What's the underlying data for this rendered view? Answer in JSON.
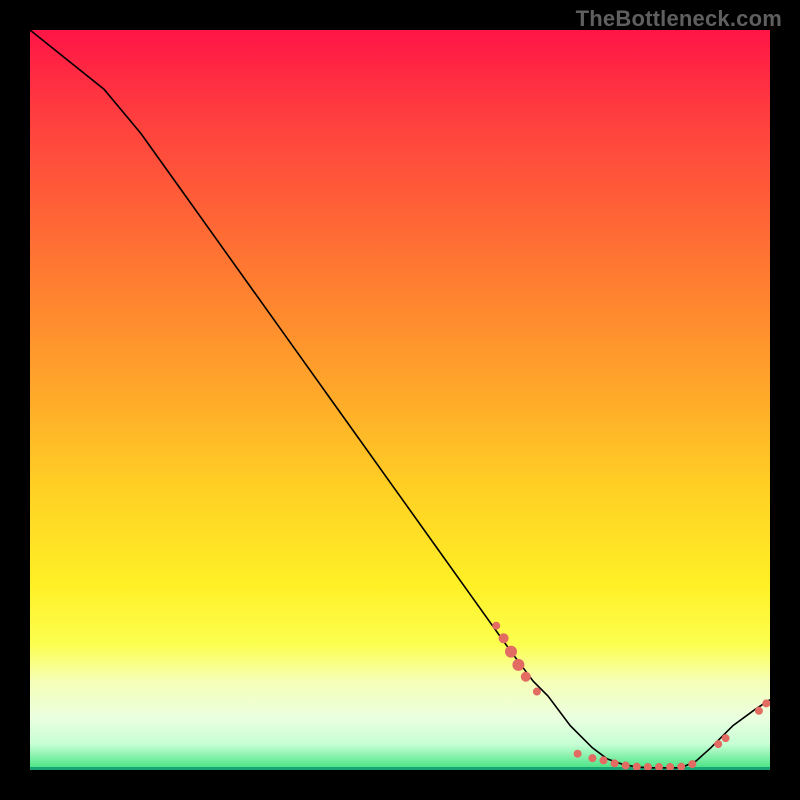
{
  "watermark": "TheBottleneck.com",
  "chart_data": {
    "type": "line",
    "title": "",
    "xlabel": "",
    "ylabel": "",
    "xlim": [
      0,
      100
    ],
    "ylim": [
      0,
      100
    ],
    "grid": false,
    "legend": false,
    "annotations": [],
    "curve": {
      "x": [
        0,
        5,
        10,
        15,
        20,
        25,
        30,
        35,
        40,
        45,
        50,
        55,
        60,
        65,
        68,
        70,
        73,
        76,
        78,
        80,
        82,
        84,
        86,
        88,
        90,
        92,
        95,
        98,
        100
      ],
      "y": [
        100,
        96,
        92,
        86,
        79,
        72,
        65,
        58,
        51,
        44,
        37,
        30,
        23,
        16,
        12,
        10,
        6,
        3,
        1.5,
        0.8,
        0.4,
        0.3,
        0.3,
        0.3,
        1.2,
        3.0,
        6.0,
        8.2,
        9.5
      ]
    },
    "scatter_clusters": [
      {
        "name": "left-slope-dots",
        "points": [
          {
            "x": 63,
            "y": 19.5,
            "r": 4
          },
          {
            "x": 64,
            "y": 17.8,
            "r": 5
          },
          {
            "x": 65,
            "y": 16.0,
            "r": 6
          },
          {
            "x": 66,
            "y": 14.2,
            "r": 6
          },
          {
            "x": 67,
            "y": 12.6,
            "r": 5
          },
          {
            "x": 68.5,
            "y": 10.6,
            "r": 4
          }
        ]
      },
      {
        "name": "valley-dots",
        "points": [
          {
            "x": 74,
            "y": 2.2,
            "r": 4
          },
          {
            "x": 76,
            "y": 1.6,
            "r": 4
          },
          {
            "x": 77.5,
            "y": 1.3,
            "r": 4
          },
          {
            "x": 79,
            "y": 0.9,
            "r": 4
          },
          {
            "x": 80.5,
            "y": 0.6,
            "r": 4
          },
          {
            "x": 82,
            "y": 0.45,
            "r": 4
          },
          {
            "x": 83.5,
            "y": 0.4,
            "r": 4
          },
          {
            "x": 85,
            "y": 0.4,
            "r": 4
          },
          {
            "x": 86.5,
            "y": 0.4,
            "r": 4
          },
          {
            "x": 88,
            "y": 0.45,
            "r": 4
          },
          {
            "x": 89.5,
            "y": 0.8,
            "r": 4
          }
        ]
      },
      {
        "name": "right-rise-dots",
        "points": [
          {
            "x": 93,
            "y": 3.5,
            "r": 4
          },
          {
            "x": 94,
            "y": 4.3,
            "r": 4
          },
          {
            "x": 98.5,
            "y": 8.0,
            "r": 4
          },
          {
            "x": 99.5,
            "y": 9.0,
            "r": 4
          }
        ]
      }
    ],
    "colors": {
      "curve": "#000000",
      "dots": "#e26b62",
      "gradient_top": "#ff1546",
      "gradient_mid": "#fff026",
      "gradient_bottom": "#3fe27e"
    }
  }
}
